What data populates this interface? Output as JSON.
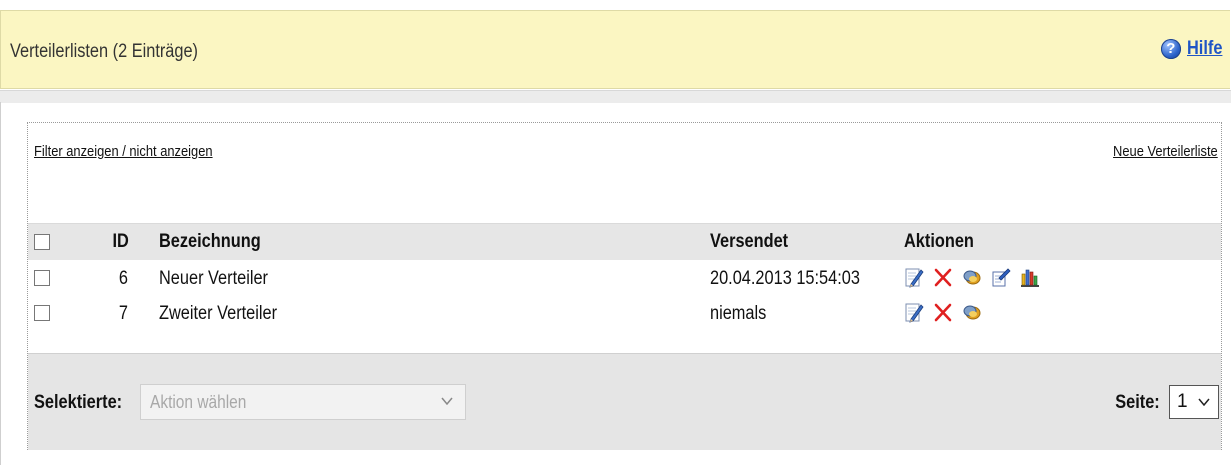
{
  "header": {
    "title": "Verteilerlisten (2 Einträge)",
    "help_icon": "help-icon",
    "help_label": "Hilfe"
  },
  "toolbar": {
    "filter_link": "Filter anzeigen / nicht anzeigen",
    "new_link": "Neue Verteilerliste"
  },
  "table": {
    "columns": [
      "ID",
      "Bezeichnung",
      "Versendet",
      "Aktionen"
    ],
    "rows": [
      {
        "id": "6",
        "name": "Neuer Verteiler",
        "sent": "20.04.2013 15:54:03",
        "actions": [
          "edit-icon",
          "delete-icon",
          "copy-icon",
          "send-icon",
          "statistics-icon"
        ]
      },
      {
        "id": "7",
        "name": "Zweiter Verteiler",
        "sent": "niemals",
        "actions": [
          "edit-icon",
          "delete-icon",
          "copy-icon"
        ]
      }
    ]
  },
  "footer": {
    "selected_label": "Selektierte:",
    "action_placeholder": "Aktion wählen",
    "page_label": "Seite:",
    "page_value": "1"
  },
  "colors": {
    "header_bg": "#fbf6c2",
    "link_blue": "#1f55c6",
    "delete_red": "#e02020"
  }
}
